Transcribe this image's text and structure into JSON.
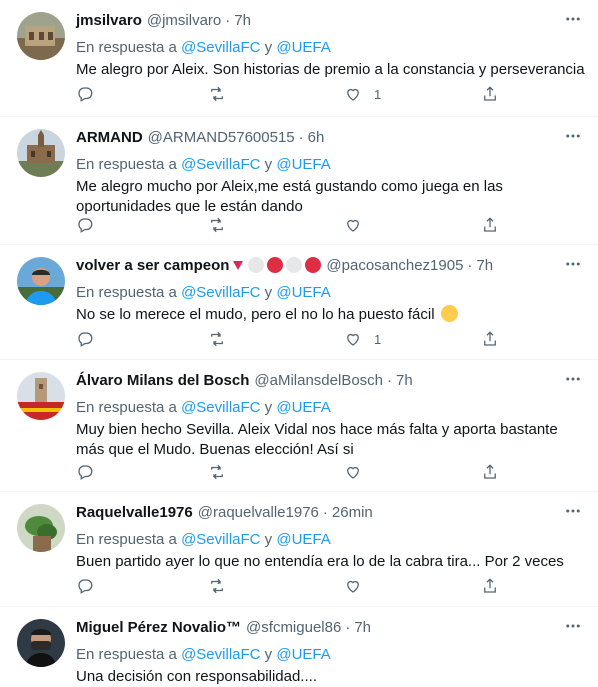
{
  "reply_prefix": "En respuesta a",
  "reply_and": "y",
  "colors": {
    "link": "#1d9bf0",
    "muted": "#536471",
    "text": "#0f1419",
    "like_red": "#e0245e"
  },
  "tweets": [
    {
      "name": "jmsilvaro",
      "handle": "@jmsilvaro",
      "time": "7h",
      "reply_to": [
        "@SevillaFC",
        "@UEFA"
      ],
      "text": "Me alegro por Aleix. Son historias de premio a la constancia y perseverancia",
      "likes": "1",
      "avatar_icon": "building-photo-avatar"
    },
    {
      "name": "ARMAND",
      "handle": "@ARMAND57600515",
      "time": "6h",
      "reply_to": [
        "@SevillaFC",
        "@UEFA"
      ],
      "text": "Me alegro mucho por Aleix,me está gustando como juega en las oportunidades que le están dando",
      "likes": "",
      "avatar_icon": "cathedral-photo-avatar"
    },
    {
      "name": "volver a ser campeon",
      "handle": "@pacosanchez1905",
      "time": "7h",
      "reply_to": [
        "@SevillaFC",
        "@UEFA"
      ],
      "text": "No se lo merece el mudo, pero el no lo ha puesto fácil",
      "likes": "1",
      "avatar_icon": "man-photo-avatar",
      "name_emojis": [
        "red-triangle",
        "white-circle",
        "red-circle",
        "white-circle",
        "red-circle"
      ]
    },
    {
      "name": "Álvaro Milans del Bosch",
      "handle": "@aMilansdelBosch",
      "time": "7h",
      "reply_to": [
        "@SevillaFC",
        "@UEFA"
      ],
      "text": "Muy bien hecho Sevilla. Aleix Vidal nos hace más falta y aporta bastante más que el Mudo. Buenas elección! Así si",
      "likes": "",
      "avatar_icon": "tower-photo-avatar"
    },
    {
      "name": "Raquelvalle1976",
      "handle": "@raquelvalle1976",
      "time": "26min",
      "reply_to": [
        "@SevillaFC",
        "@UEFA"
      ],
      "text": "Buen partido ayer lo que no entendía era lo de la cabra tira... Por 2 veces",
      "likes": "",
      "avatar_icon": "plant-photo-avatar"
    },
    {
      "name": "Miguel Pérez Novalio™",
      "handle": "@sfcmiguel86",
      "time": "7h",
      "reply_to": [
        "@SevillaFC",
        "@UEFA"
      ],
      "text": "Una decisión con responsabilidad....",
      "likes": "",
      "avatar_icon": "masked-man-photo-avatar"
    }
  ]
}
